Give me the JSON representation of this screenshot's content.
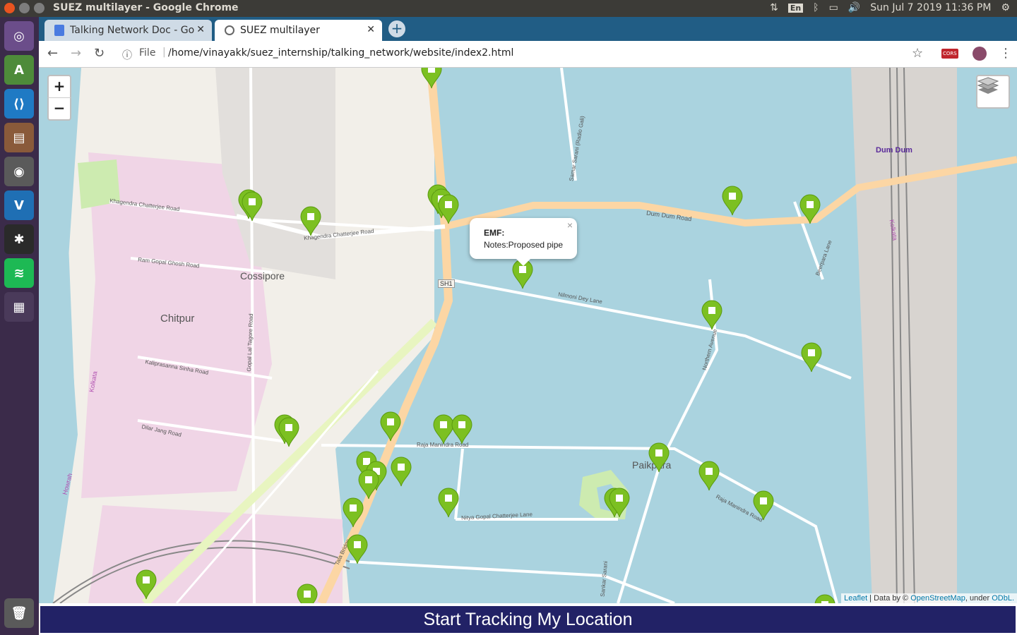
{
  "os": {
    "window_title": "SUEZ multilayer - Google Chrome",
    "tray": {
      "keyboard": "En",
      "datetime": "Sun Jul  7 2019 11:36 PM"
    },
    "launcher": [
      "ubuntu-dash-icon",
      "android-studio-icon",
      "vscode-icon",
      "files-icon",
      "chrome-icon",
      "virtualbox-icon",
      "spider-icon",
      "spotify-icon",
      "workspace-icon",
      "trash-icon"
    ]
  },
  "browser": {
    "tabs": [
      {
        "label": "Talking Network Doc - Go"
      },
      {
        "label": "SUEZ multilayer"
      }
    ],
    "url_scheme": "File",
    "url": "/home/vinayakk/suez_internship/talking_network/website/index2.html",
    "extension_badge": "CORS"
  },
  "map": {
    "zoom_in": "+",
    "zoom_out": "−",
    "popup": {
      "title": "EMF:",
      "notes": "Notes:Proposed pipe",
      "close": "×"
    },
    "labels": {
      "cossipore": "Cossipore",
      "chitpur": "Chitpur",
      "paikpara": "Paikpara",
      "dum_dum": "Dum Dum",
      "dum_dum_road": "Dum Dum Road",
      "khagendra1": "Khagendra Chatterjee Road",
      "khagendra2": "Khagendra Chatterjee Road",
      "ram_gopal": "Ram Gopal Ghosh Road",
      "kaliprasanna": "Kaliprasanna Sinha Road",
      "dilar_jang": "Dilar Jang Road",
      "gopal_lal": "Gopal Lal Tagore Road",
      "nilmoni": "Nilmoni Dey Lane",
      "raja_manindra1": "Raja Manindra Road",
      "raja_manindra2": "Raja Manindra Road",
      "nitya_gopal": "Nitya Gopal Chatterjee Lane",
      "northern_avenue": "Northern Avenue",
      "samar_sarani": "Samar Sarani (Radio Gali)",
      "beerpara": "Beerpara Lane",
      "tala_bridge": "Tala Bridge",
      "sh1": "SH1",
      "kolkata1": "Kolkata",
      "kolkata2": "Kolkata",
      "howrah": "Howrah",
      "sankar_sarani": "Sankar Sarani"
    },
    "attribution": {
      "leaflet": "Leaflet",
      "data_by": " | Data by © ",
      "osm": "OpenStreetMap",
      "under": ", under ",
      "odbl": "ODbL."
    }
  },
  "track_button": "Start Tracking My Location",
  "colors": {
    "water": "#aad3df",
    "land": "#f2efe9",
    "marker": "#7cc022",
    "primary_road": "#fcd6a4",
    "track_button": "#222266"
  }
}
